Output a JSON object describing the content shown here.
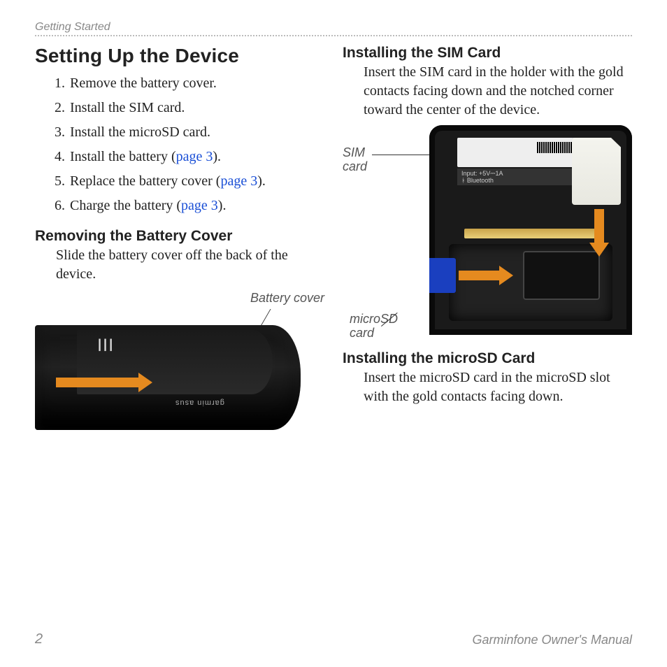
{
  "header": {
    "section": "Getting Started"
  },
  "left": {
    "h1": "Setting Up the Device",
    "steps": [
      {
        "text": "Remove the battery cover."
      },
      {
        "text": "Install the SIM card."
      },
      {
        "text": "Install the microSD card."
      },
      {
        "text_a": "Install the battery (",
        "link": "page 3",
        "text_b": ")."
      },
      {
        "text_a": "Replace the battery cover (",
        "link": "page 3",
        "text_b": ")."
      },
      {
        "text_a": "Charge the battery (",
        "link": "page 3",
        "text_b": ")."
      }
    ],
    "h2": "Removing the Battery Cover",
    "body": "Slide the battery cover off the back of the device.",
    "fig1": {
      "caption": "Battery cover",
      "brand": "garmin asus"
    }
  },
  "right": {
    "h2a": "Installing the SIM Card",
    "body_a": "Insert the SIM card in the holder with the gold contacts facing down and the notched corner toward the center of the device.",
    "fig2": {
      "caption_sim_l1": "SIM",
      "caption_sim_l2": "card",
      "caption_msd_l1": "microSD",
      "caption_msd_l2": "card",
      "info_line1": "Input: +5V⎓1A",
      "info_line2": "Bluetooth"
    },
    "h2b": "Installing the microSD Card",
    "body_b": "Insert the microSD card in the microSD slot with the gold contacts facing down."
  },
  "footer": {
    "page": "2",
    "title": "Garminfone Owner's Manual"
  }
}
